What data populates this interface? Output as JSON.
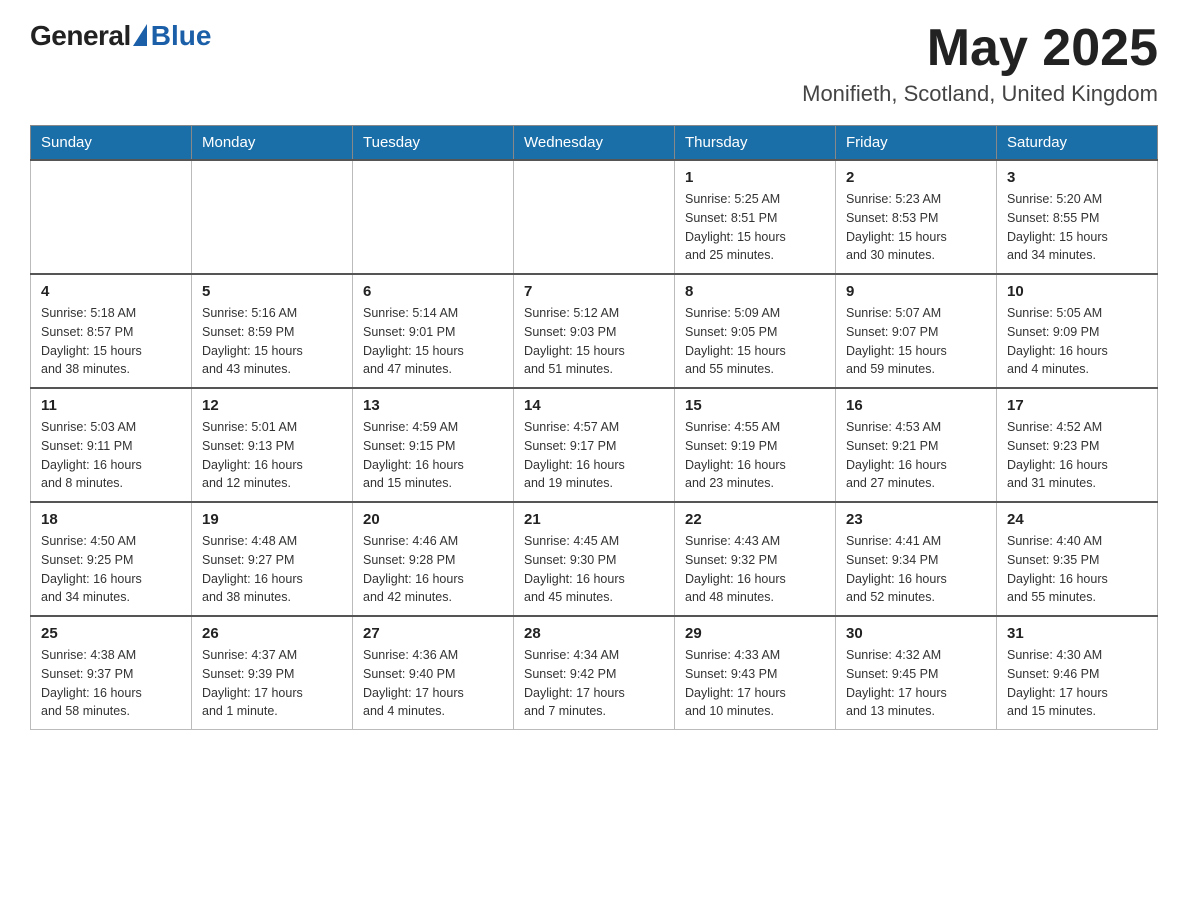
{
  "header": {
    "logo_general": "General",
    "logo_blue": "Blue",
    "month_title": "May 2025",
    "location": "Monifieth, Scotland, United Kingdom"
  },
  "weekdays": [
    "Sunday",
    "Monday",
    "Tuesday",
    "Wednesday",
    "Thursday",
    "Friday",
    "Saturday"
  ],
  "weeks": [
    {
      "days": [
        {
          "num": "",
          "info": ""
        },
        {
          "num": "",
          "info": ""
        },
        {
          "num": "",
          "info": ""
        },
        {
          "num": "",
          "info": ""
        },
        {
          "num": "1",
          "info": "Sunrise: 5:25 AM\nSunset: 8:51 PM\nDaylight: 15 hours\nand 25 minutes."
        },
        {
          "num": "2",
          "info": "Sunrise: 5:23 AM\nSunset: 8:53 PM\nDaylight: 15 hours\nand 30 minutes."
        },
        {
          "num": "3",
          "info": "Sunrise: 5:20 AM\nSunset: 8:55 PM\nDaylight: 15 hours\nand 34 minutes."
        }
      ]
    },
    {
      "days": [
        {
          "num": "4",
          "info": "Sunrise: 5:18 AM\nSunset: 8:57 PM\nDaylight: 15 hours\nand 38 minutes."
        },
        {
          "num": "5",
          "info": "Sunrise: 5:16 AM\nSunset: 8:59 PM\nDaylight: 15 hours\nand 43 minutes."
        },
        {
          "num": "6",
          "info": "Sunrise: 5:14 AM\nSunset: 9:01 PM\nDaylight: 15 hours\nand 47 minutes."
        },
        {
          "num": "7",
          "info": "Sunrise: 5:12 AM\nSunset: 9:03 PM\nDaylight: 15 hours\nand 51 minutes."
        },
        {
          "num": "8",
          "info": "Sunrise: 5:09 AM\nSunset: 9:05 PM\nDaylight: 15 hours\nand 55 minutes."
        },
        {
          "num": "9",
          "info": "Sunrise: 5:07 AM\nSunset: 9:07 PM\nDaylight: 15 hours\nand 59 minutes."
        },
        {
          "num": "10",
          "info": "Sunrise: 5:05 AM\nSunset: 9:09 PM\nDaylight: 16 hours\nand 4 minutes."
        }
      ]
    },
    {
      "days": [
        {
          "num": "11",
          "info": "Sunrise: 5:03 AM\nSunset: 9:11 PM\nDaylight: 16 hours\nand 8 minutes."
        },
        {
          "num": "12",
          "info": "Sunrise: 5:01 AM\nSunset: 9:13 PM\nDaylight: 16 hours\nand 12 minutes."
        },
        {
          "num": "13",
          "info": "Sunrise: 4:59 AM\nSunset: 9:15 PM\nDaylight: 16 hours\nand 15 minutes."
        },
        {
          "num": "14",
          "info": "Sunrise: 4:57 AM\nSunset: 9:17 PM\nDaylight: 16 hours\nand 19 minutes."
        },
        {
          "num": "15",
          "info": "Sunrise: 4:55 AM\nSunset: 9:19 PM\nDaylight: 16 hours\nand 23 minutes."
        },
        {
          "num": "16",
          "info": "Sunrise: 4:53 AM\nSunset: 9:21 PM\nDaylight: 16 hours\nand 27 minutes."
        },
        {
          "num": "17",
          "info": "Sunrise: 4:52 AM\nSunset: 9:23 PM\nDaylight: 16 hours\nand 31 minutes."
        }
      ]
    },
    {
      "days": [
        {
          "num": "18",
          "info": "Sunrise: 4:50 AM\nSunset: 9:25 PM\nDaylight: 16 hours\nand 34 minutes."
        },
        {
          "num": "19",
          "info": "Sunrise: 4:48 AM\nSunset: 9:27 PM\nDaylight: 16 hours\nand 38 minutes."
        },
        {
          "num": "20",
          "info": "Sunrise: 4:46 AM\nSunset: 9:28 PM\nDaylight: 16 hours\nand 42 minutes."
        },
        {
          "num": "21",
          "info": "Sunrise: 4:45 AM\nSunset: 9:30 PM\nDaylight: 16 hours\nand 45 minutes."
        },
        {
          "num": "22",
          "info": "Sunrise: 4:43 AM\nSunset: 9:32 PM\nDaylight: 16 hours\nand 48 minutes."
        },
        {
          "num": "23",
          "info": "Sunrise: 4:41 AM\nSunset: 9:34 PM\nDaylight: 16 hours\nand 52 minutes."
        },
        {
          "num": "24",
          "info": "Sunrise: 4:40 AM\nSunset: 9:35 PM\nDaylight: 16 hours\nand 55 minutes."
        }
      ]
    },
    {
      "days": [
        {
          "num": "25",
          "info": "Sunrise: 4:38 AM\nSunset: 9:37 PM\nDaylight: 16 hours\nand 58 minutes."
        },
        {
          "num": "26",
          "info": "Sunrise: 4:37 AM\nSunset: 9:39 PM\nDaylight: 17 hours\nand 1 minute."
        },
        {
          "num": "27",
          "info": "Sunrise: 4:36 AM\nSunset: 9:40 PM\nDaylight: 17 hours\nand 4 minutes."
        },
        {
          "num": "28",
          "info": "Sunrise: 4:34 AM\nSunset: 9:42 PM\nDaylight: 17 hours\nand 7 minutes."
        },
        {
          "num": "29",
          "info": "Sunrise: 4:33 AM\nSunset: 9:43 PM\nDaylight: 17 hours\nand 10 minutes."
        },
        {
          "num": "30",
          "info": "Sunrise: 4:32 AM\nSunset: 9:45 PM\nDaylight: 17 hours\nand 13 minutes."
        },
        {
          "num": "31",
          "info": "Sunrise: 4:30 AM\nSunset: 9:46 PM\nDaylight: 17 hours\nand 15 minutes."
        }
      ]
    }
  ]
}
